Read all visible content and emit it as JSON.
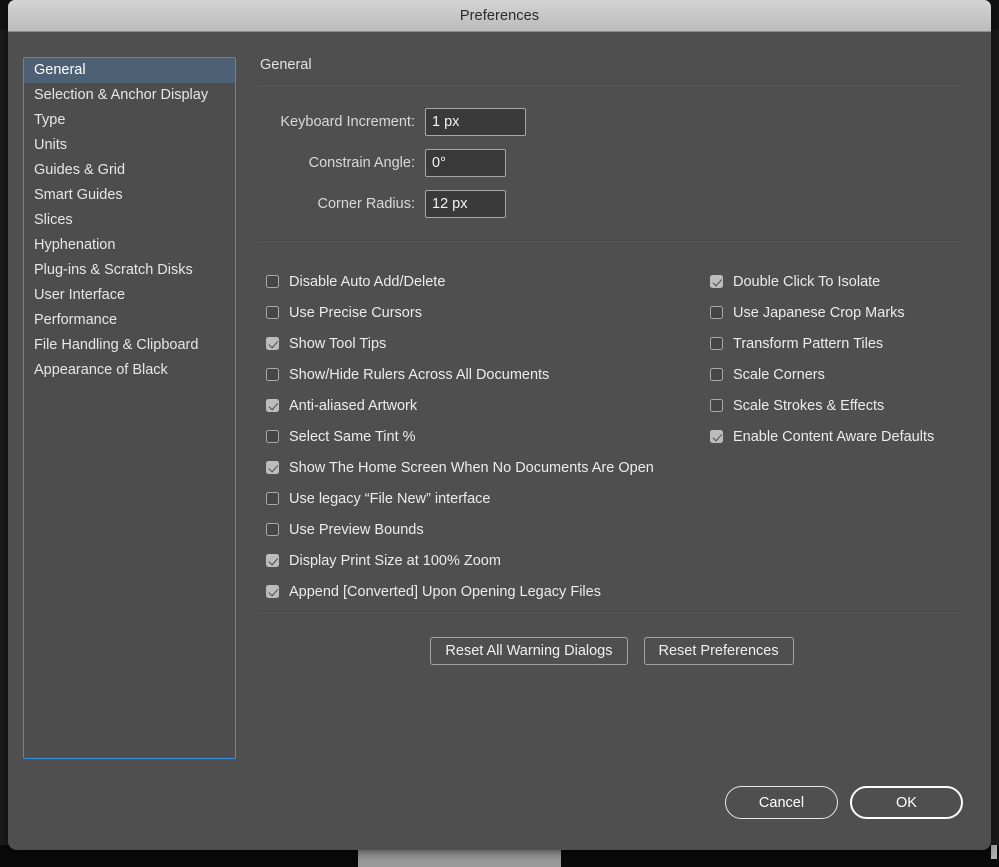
{
  "window": {
    "title": "Preferences"
  },
  "sidebar": {
    "selected": "General",
    "items": [
      {
        "label": "General"
      },
      {
        "label": "Selection & Anchor Display"
      },
      {
        "label": "Type"
      },
      {
        "label": "Units"
      },
      {
        "label": "Guides & Grid"
      },
      {
        "label": "Smart Guides"
      },
      {
        "label": "Slices"
      },
      {
        "label": "Hyphenation"
      },
      {
        "label": "Plug-ins & Scratch Disks"
      },
      {
        "label": "User Interface"
      },
      {
        "label": "Performance"
      },
      {
        "label": "File Handling & Clipboard"
      },
      {
        "label": "Appearance of Black"
      }
    ]
  },
  "panel": {
    "title": "General",
    "fields": [
      {
        "label": "Keyboard Increment:",
        "value": "1 px"
      },
      {
        "label": "Constrain Angle:",
        "value": "0°"
      },
      {
        "label": "Corner Radius:",
        "value": "12 px"
      }
    ],
    "checkboxes_left": [
      {
        "label": "Disable Auto Add/Delete",
        "checked": false
      },
      {
        "label": "Use Precise Cursors",
        "checked": false
      },
      {
        "label": "Show Tool Tips",
        "checked": true
      },
      {
        "label": "Show/Hide Rulers Across All Documents",
        "checked": false
      },
      {
        "label": "Anti-aliased Artwork",
        "checked": true
      },
      {
        "label": "Select Same Tint %",
        "checked": false
      },
      {
        "label": "Show The Home Screen When No Documents Are Open",
        "checked": true
      },
      {
        "label": "Use legacy “File New” interface",
        "checked": false
      },
      {
        "label": "Use Preview Bounds",
        "checked": false
      },
      {
        "label": "Display Print Size at 100% Zoom",
        "checked": true
      },
      {
        "label": "Append [Converted] Upon Opening Legacy Files",
        "checked": true
      }
    ],
    "checkboxes_right": [
      {
        "label": "Double Click To Isolate",
        "checked": true
      },
      {
        "label": "Use Japanese Crop Marks",
        "checked": false
      },
      {
        "label": "Transform Pattern Tiles",
        "checked": false
      },
      {
        "label": "Scale Corners",
        "checked": false
      },
      {
        "label": "Scale Strokes & Effects",
        "checked": false
      },
      {
        "label": "Enable Content Aware Defaults",
        "checked": true
      }
    ],
    "reset_buttons": [
      {
        "label": "Reset All Warning Dialogs"
      },
      {
        "label": "Reset Preferences"
      }
    ]
  },
  "footer": {
    "cancel_label": "Cancel",
    "ok_label": "OK"
  },
  "colors": {
    "dialog_background": "#4f4f4f",
    "titlebar": "#c8c8c8",
    "sidebar_border": "#3b8fe0",
    "sidebar_selected": "#4d6074",
    "input_background": "#3a3a3a",
    "checkbox_checked": "#bcbcbc",
    "text": "#ececec"
  }
}
